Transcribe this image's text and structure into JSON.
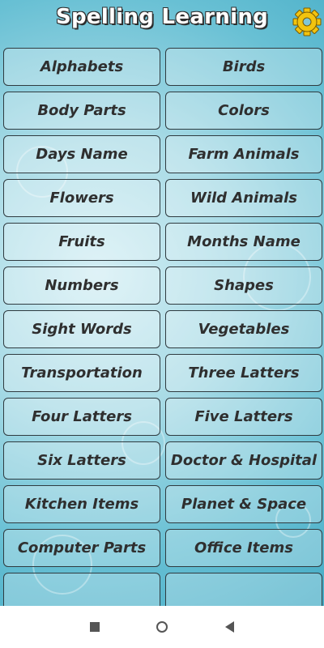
{
  "header": {
    "title": "Spelling Learning",
    "settings_icon": "gear-icon",
    "gear_color": "#f2c40f"
  },
  "categories": [
    {
      "label": "Alphabets"
    },
    {
      "label": "Birds"
    },
    {
      "label": "Body Parts"
    },
    {
      "label": "Colors"
    },
    {
      "label": "Days Name"
    },
    {
      "label": "Farm Animals"
    },
    {
      "label": "Flowers"
    },
    {
      "label": "Wild Animals"
    },
    {
      "label": "Fruits"
    },
    {
      "label": "Months Name"
    },
    {
      "label": "Numbers"
    },
    {
      "label": "Shapes"
    },
    {
      "label": "Sight Words"
    },
    {
      "label": "Vegetables"
    },
    {
      "label": "Transportation"
    },
    {
      "label": "Three Latters"
    },
    {
      "label": "Four Latters"
    },
    {
      "label": "Five Latters"
    },
    {
      "label": "Six Latters"
    },
    {
      "label": "Doctor & Hospital"
    },
    {
      "label": "Kitchen Items"
    },
    {
      "label": "Planet & Space"
    },
    {
      "label": "Computer Parts"
    },
    {
      "label": "Office Items"
    },
    {
      "label": ""
    },
    {
      "label": ""
    }
  ],
  "navbar": {
    "recents_icon": "square-icon",
    "home_icon": "circle-icon",
    "back_icon": "back-triangle-icon"
  }
}
